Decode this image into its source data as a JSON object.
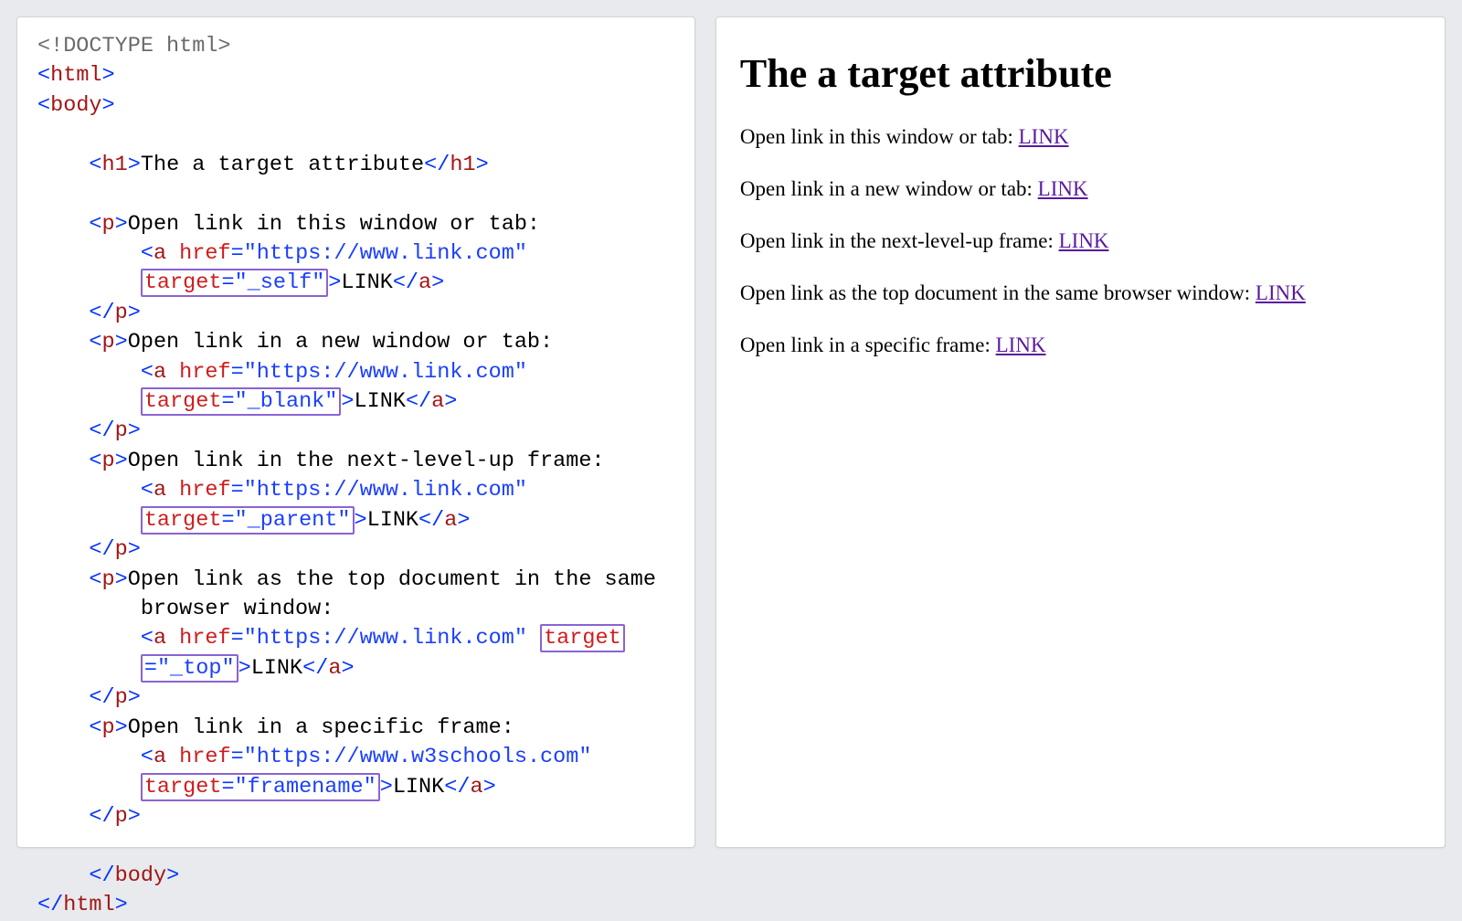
{
  "code": {
    "doctype": "<!DOCTYPE html>",
    "html_open": "html",
    "body_open": "body",
    "h1": {
      "tag": "h1",
      "text": "The a target attribute"
    },
    "href1": "https://www.link.com",
    "href2": "https://www.link.com",
    "href3": "https://www.link.com",
    "href4": "https://www.link.com",
    "href5": "https://www.w3schools.com",
    "target_attr": "target",
    "target1": "_self",
    "target2": "_blank",
    "target3": "_parent",
    "target4": "_top",
    "target5": "framename",
    "link_text": "LINK",
    "p1_text": "Open link in this window or tab:",
    "p2_text": "Open link in a new window or tab:",
    "p3_text": "Open link in the next-level-up frame:",
    "p4_text_a": "Open link as the top document in the same",
    "p4_text_b": "browser window:",
    "p5_text": "Open link in a specific frame:",
    "a_tag": "a",
    "p_tag": "p",
    "href_attr": "href",
    "eq": "=",
    "lt": "<",
    "gt": ">",
    "slash": "/",
    "quote": "\""
  },
  "preview": {
    "heading": "The a target attribute",
    "items": [
      {
        "text": "Open link in this window or tab: ",
        "link": "LINK"
      },
      {
        "text": "Open link in a new window or tab: ",
        "link": "LINK"
      },
      {
        "text": "Open link in the next-level-up frame: ",
        "link": "LINK"
      },
      {
        "text": "Open link as the top document in the same browser window: ",
        "link": "LINK"
      },
      {
        "text": "Open link in a specific frame: ",
        "link": "LINK"
      }
    ]
  }
}
